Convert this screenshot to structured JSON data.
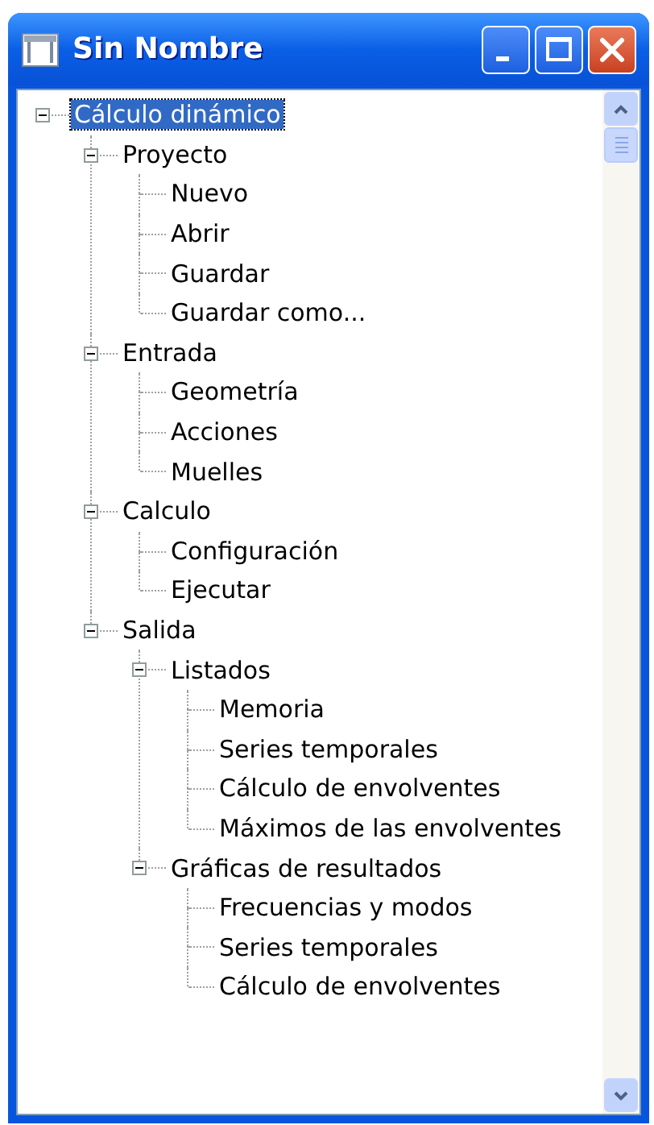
{
  "window": {
    "title": "Sin Nombre"
  },
  "tree": [
    {
      "label": "Cálculo dinámico",
      "selected": true,
      "expanded": true,
      "children": [
        {
          "label": "Proyecto",
          "selected": false,
          "expanded": true,
          "children": [
            {
              "label": "Nuevo",
              "selected": false
            },
            {
              "label": "Abrir",
              "selected": false
            },
            {
              "label": "Guardar",
              "selected": false
            },
            {
              "label": "Guardar como...",
              "selected": false
            }
          ]
        },
        {
          "label": "Entrada",
          "selected": false,
          "expanded": true,
          "children": [
            {
              "label": "Geometría",
              "selected": false
            },
            {
              "label": "Acciones",
              "selected": false
            },
            {
              "label": "Muelles",
              "selected": false
            }
          ]
        },
        {
          "label": "Calculo",
          "selected": false,
          "expanded": true,
          "children": [
            {
              "label": "Configuración",
              "selected": false
            },
            {
              "label": "Ejecutar",
              "selected": false
            }
          ]
        },
        {
          "label": "Salida",
          "selected": false,
          "expanded": true,
          "children": [
            {
              "label": "Listados",
              "selected": false,
              "expanded": true,
              "children": [
                {
                  "label": "Memoria",
                  "selected": false
                },
                {
                  "label": "Series temporales",
                  "selected": false
                },
                {
                  "label": "Cálculo de envolventes",
                  "selected": false
                },
                {
                  "label": "Máximos de las envolventes",
                  "selected": false
                }
              ]
            },
            {
              "label": "Gráficas de resultados",
              "selected": false,
              "expanded": true,
              "children": [
                {
                  "label": "Frecuencias y modos",
                  "selected": false
                },
                {
                  "label": "Series temporales",
                  "selected": false
                },
                {
                  "label": "Cálculo de envolventes",
                  "selected": false
                }
              ]
            }
          ]
        }
      ]
    }
  ]
}
